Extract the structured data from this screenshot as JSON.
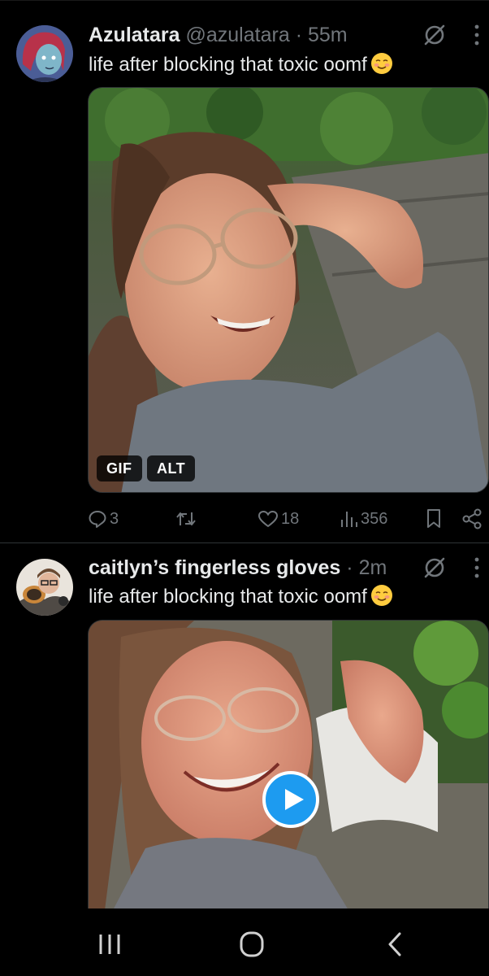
{
  "tweets": [
    {
      "name": "Azulatara",
      "handle": "@azulatara",
      "separator": "·",
      "time": "55m",
      "text": "life after blocking that toxic oomf",
      "emoji": "smiling-face-icon",
      "media_type": "gif",
      "badges": {
        "gif": "GIF",
        "alt": "ALT"
      },
      "stats": {
        "replies": "3",
        "retweets": "",
        "likes": "18",
        "views": "356"
      }
    },
    {
      "name": "caitlyn’s fingerless gloves",
      "separator": "·",
      "time": "2m",
      "text": "life after blocking that toxic oomf",
      "emoji": "smiling-face-icon",
      "media_type": "video"
    }
  ],
  "navbar": {
    "icons": [
      "recent-apps-icon",
      "home-icon",
      "back-icon"
    ]
  },
  "colors": {
    "background": "#000000",
    "text": "#e7e9ea",
    "muted": "#71767b",
    "accent": "#1d9bf0"
  }
}
